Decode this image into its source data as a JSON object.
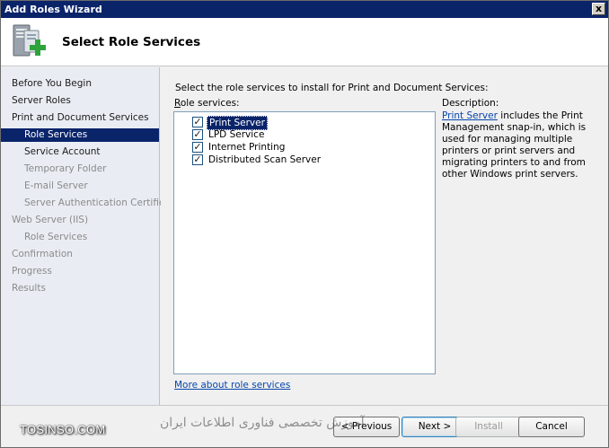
{
  "window": {
    "title": "Add Roles Wizard",
    "close_glyph": "x"
  },
  "header": {
    "title": "Select Role Services",
    "icon": "server-role-add-icon"
  },
  "nav": {
    "items": [
      {
        "label": "Before You Begin",
        "state": "normal"
      },
      {
        "label": "Server Roles",
        "state": "normal"
      },
      {
        "label": "Print and Document Services",
        "state": "normal"
      },
      {
        "label": "Role Services",
        "state": "selected"
      },
      {
        "label": "Service Account",
        "state": "normal"
      },
      {
        "label": "Temporary Folder",
        "state": "disabled"
      },
      {
        "label": "E-mail Server",
        "state": "disabled"
      },
      {
        "label": "Server Authentication Certificate",
        "state": "disabled"
      },
      {
        "label": "Web Server (IIS)",
        "state": "disabled"
      },
      {
        "label": "Role Services",
        "state": "disabled"
      },
      {
        "label": "Confirmation",
        "state": "disabled"
      },
      {
        "label": "Progress",
        "state": "disabled"
      },
      {
        "label": "Results",
        "state": "disabled"
      }
    ]
  },
  "main": {
    "instruction": "Select the role services to install for Print and Document Services:",
    "list_label_accel": "R",
    "list_label_rest": "ole services:",
    "role_services": [
      {
        "label": "Print Server",
        "checked": true,
        "selected": true
      },
      {
        "label": "LPD Service",
        "checked": true,
        "selected": false
      },
      {
        "label": "Internet Printing",
        "checked": true,
        "selected": false
      },
      {
        "label": "Distributed Scan Server",
        "checked": true,
        "selected": false
      }
    ],
    "description_heading": "Description:",
    "description_link": "Print Server",
    "description_text": " includes the Print Management snap-in, which is used for managing multiple printers or print servers and migrating printers to and from other Windows print servers.",
    "more_link": "More about role services",
    "checkmark_glyph": "✓"
  },
  "footer": {
    "previous_label": "< Previous",
    "next_label": "Next >",
    "install_label": "Install",
    "cancel_label": "Cancel"
  },
  "watermark": {
    "site": "TOSINSO.COM",
    "tagline": "آموزش تخصصی فناوری اطلاعات ایران"
  }
}
